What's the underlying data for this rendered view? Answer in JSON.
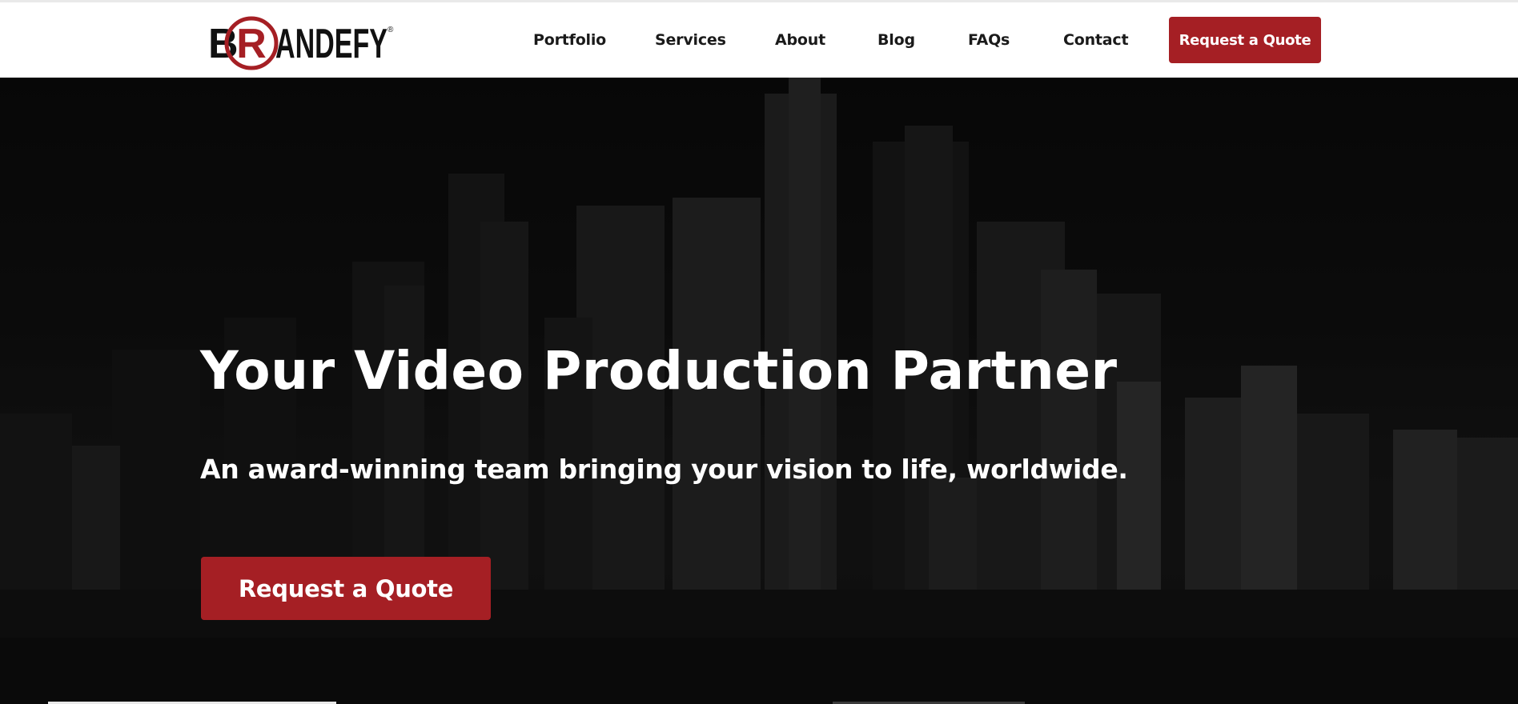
{
  "brand": {
    "logo_letters_before": "B",
    "logo_letter_circled": "R",
    "logo_letters_after": "ANDEFY",
    "registered_mark": "®",
    "accent_color": "#a51f24"
  },
  "nav": {
    "items": [
      {
        "label": "Portfolio"
      },
      {
        "label": "Services"
      },
      {
        "label": "About"
      },
      {
        "label": "Blog"
      },
      {
        "label": "FAQs"
      },
      {
        "label": "Contact"
      }
    ],
    "cta_label": "Request a Quote"
  },
  "hero": {
    "title": "Your Video Production Partner",
    "subtitle": "An award-winning team bringing your vision to life, worldwide.",
    "cta_label": "Request a Quote",
    "background": "city-skyline-image"
  }
}
